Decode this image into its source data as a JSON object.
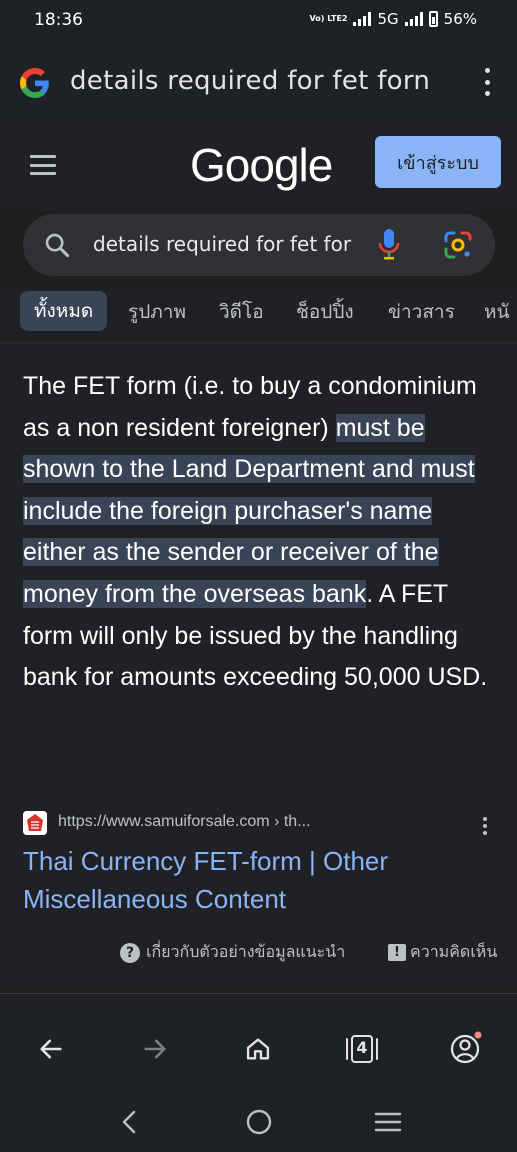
{
  "status_bar": {
    "time": "18:36",
    "volte_label": "Vo) LTE2",
    "network": "5G",
    "battery": "56%"
  },
  "browser": {
    "url_text": "details required for fet forn",
    "menu_icon": "more-vert-icon"
  },
  "google_header": {
    "logo_text": "Google",
    "sign_in_label": "เข้าสู่ระบบ"
  },
  "search": {
    "query": "details required for fet for"
  },
  "tabs": [
    {
      "label": "ทั้งหมด",
      "active": true
    },
    {
      "label": "รูปภาพ",
      "active": false
    },
    {
      "label": "วิดีโอ",
      "active": false
    },
    {
      "label": "ช็อปปิ้ง",
      "active": false
    },
    {
      "label": "ข่าวสาร",
      "active": false
    },
    {
      "label": "หนั",
      "active": false
    }
  ],
  "result": {
    "snippet_before": "The FET form (i.e. to buy a condominium as a non resident foreigner) ",
    "snippet_highlight": "must be shown to the Land Department and must include the foreign purchaser's name either as the sender or receiver of the money from the overseas bank",
    "snippet_after": ". A FET form will only be issued by the handling bank for amounts exceeding 50,000 USD.",
    "source_url": "https://www.samuiforsale.com › th...",
    "title": "Thai Currency FET-form | Other Miscellaneous Content",
    "about_label": "เกี่ยวกับตัวอย่างข้อมูลแนะนำ",
    "feedback_label": "ความคิดเห็น"
  },
  "bottom_nav": {
    "tab_count": "4"
  },
  "colors": {
    "accent": "#8ab4f8",
    "highlight": "#394457",
    "background": "#202124"
  }
}
